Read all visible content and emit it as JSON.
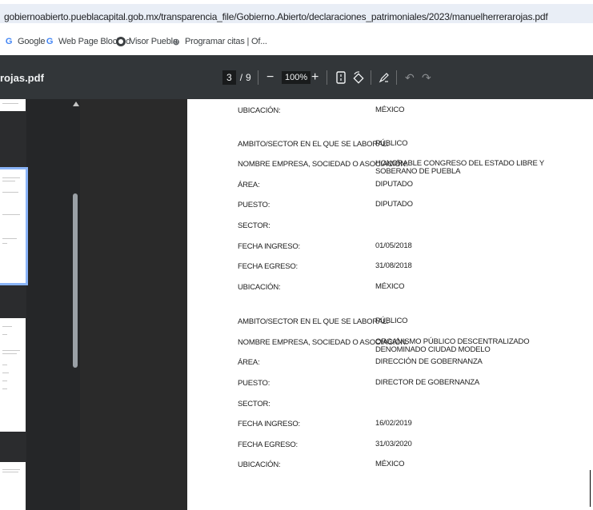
{
  "browser": {
    "url": "gobiernoabierto.pueblacapital.gob.mx/transparencia_file/Gobierno.Abierto/declaraciones_patrimoniales/2023/manuelherrerarojas.pdf",
    "bookmarks": [
      {
        "label": "Google",
        "icon": "google-icon"
      },
      {
        "label": "Web Page Blocked",
        "icon": "google-icon"
      },
      {
        "label": "Visor Puebla",
        "icon": "globe-icon"
      },
      {
        "label": "Programar citas | Of...",
        "icon": "link-icon"
      }
    ]
  },
  "pdf": {
    "title": "rojas.pdf",
    "current_page": "3",
    "page_separator": "/",
    "total_pages": "9",
    "zoom_out": "−",
    "zoom": "100%",
    "zoom_in": "+",
    "undo": "↶",
    "redo": "↷"
  },
  "document": {
    "rows": [
      {
        "key": "UBICACIÓN:",
        "value": "MÉXICO"
      },
      {
        "key": "AMBITO/SECTOR EN EL QUE SE LABORAL:",
        "value": "PÚBLICO"
      },
      {
        "key": "NOMBRE EMPRESA, SOCIEDAD O ASOCIACIÓN:",
        "value": "HONORABLE CONGRESO DEL ESTADO LIBRE Y SOBERANO DE PUEBLA"
      },
      {
        "key": "ÁREA:",
        "value": "DIPUTADO"
      },
      {
        "key": "PUESTO:",
        "value": "DIPUTADO"
      },
      {
        "key": "SECTOR:",
        "value": ""
      },
      {
        "key": "FECHA INGRESO:",
        "value": "01/05/2018"
      },
      {
        "key": "FECHA EGRESO:",
        "value": "31/08/2018"
      },
      {
        "key": "UBICACIÓN:",
        "value": "MÉXICO"
      },
      {
        "key": "AMBITO/SECTOR EN EL QUE SE LABORAL:",
        "value": "PÚBLICO"
      },
      {
        "key": "NOMBRE EMPRESA, SOCIEDAD O ASOCIACIÓN:",
        "value": "ORGANISMO PÚBLICO DESCENTRALIZADO DENOMINADO CIUDAD MODELO"
      },
      {
        "key": "ÁREA:",
        "value": "DIRECCIÓN DE GOBERNANZA"
      },
      {
        "key": "PUESTO:",
        "value": "DIRECTOR DE GOBERNANZA"
      },
      {
        "key": "SECTOR:",
        "value": ""
      },
      {
        "key": "FECHA INGRESO:",
        "value": "16/02/2019"
      },
      {
        "key": "FECHA EGRESO:",
        "value": "31/03/2020"
      },
      {
        "key": "UBICACIÓN:",
        "value": "MÉXICO"
      }
    ]
  },
  "colors": {
    "toolbar": "#323639",
    "viewer_background": "#2a2a2a",
    "thumbnail_selected": "#8ab4f8",
    "url_bar": "#e9eef6"
  }
}
